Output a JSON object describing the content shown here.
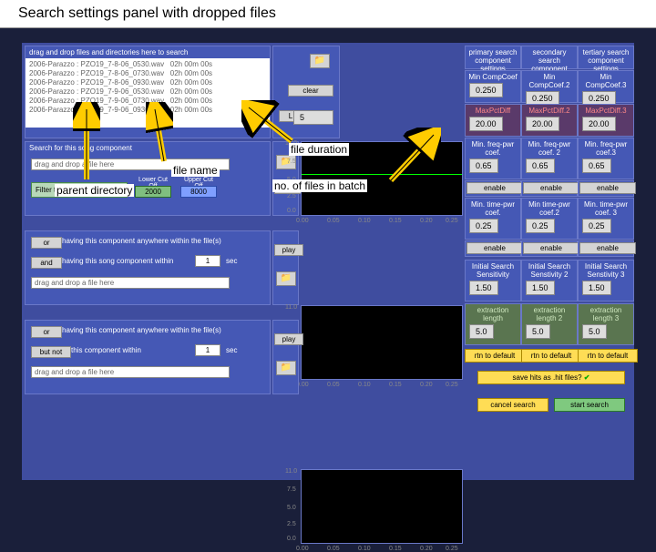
{
  "title": "Search settings panel with dropped files",
  "callouts": {
    "file_duration": "file duration",
    "file_name": "file name",
    "parent_directory": "parent directory",
    "no_files": "no. of files in batch"
  },
  "drop_header": "drag and drop files and directories here to search",
  "files": [
    {
      "dir": "2006-Parazzo",
      "name": "PZO19_7-8-06_0530.wav",
      "dur": "02h 00m 00s"
    },
    {
      "dir": "2006-Parazzo",
      "name": "PZO19_7-8-06_0730.wav",
      "dur": "02h 00m 00s"
    },
    {
      "dir": "2006-Parazzo",
      "name": "PZO19_7-8-06_0930.wav",
      "dur": "02h 00m 00s"
    },
    {
      "dir": "2006-Parazzo",
      "name": "PZO19_7-9-06_0530.wav",
      "dur": "02h 00m 00s"
    },
    {
      "dir": "2006-Parazzo",
      "name": "PZO19_7-9-06_0730.wav",
      "dur": "02h 00m 00s"
    },
    {
      "dir": "2006-Parazzo",
      "name": "PZO19_7-9-06_0930.wav",
      "dur": "02h 00m 00s"
    }
  ],
  "clear": "clear",
  "batch_count": "5",
  "stereo": "L",
  "search_for": "Search for this song component",
  "drop_msg": "drag and drop a file here",
  "filter_label": "Filter the search file",
  "lower_cutoff": "Lower Cut Off",
  "upper_cutoff": "Upper Cut Off",
  "lower_val": "2000",
  "upper_val": "8000",
  "play": "play",
  "or": "or",
  "and": "and",
  "but_not": "but not",
  "having_anywhere": "having this component anywhere within the file(s)",
  "having_within": "having this song component within",
  "this_within": "this component within",
  "sec": "sec",
  "one": "1",
  "cols": {
    "primary": "primary search component settings",
    "secondary": "secondary search component settings",
    "tertiary": "tertiary search component settings"
  },
  "min_compcoef": {
    "l": "Min CompCoef",
    "l2": "Min CompCoef.2",
    "l3": "Min CompCoef.3",
    "v1": "0.250",
    "v2": "0.250",
    "v3": "0.250"
  },
  "maxpctdiff": {
    "l": "MaxPctDiff",
    "l2": "MaxPctDiff.2",
    "l3": "MaxPctDiff.3",
    "v1": "20.00",
    "v2": "20.00",
    "v3": "20.00"
  },
  "min_freqpwr": {
    "l": "Min. freq-pwr coef.",
    "l2": "Min. freq-pwr coef. 2",
    "l3": "Min. freq-pwr coef.3",
    "v1": "0.65",
    "v2": "0.65",
    "v3": "0.65"
  },
  "enable": "enable",
  "min_timepwr": {
    "l": "Min. time-pwr coef.",
    "l2": "Min time-pwr coef.2",
    "l3": "Min. time-pwr coef. 3",
    "v1": "0.25",
    "v2": "0.25",
    "v3": "0.25"
  },
  "init_sens": {
    "l": "Initial Search Sensitivity",
    "l2": "Initial Search Senstivity 2",
    "l3": "Initial Search Senstivity 3",
    "v1": "1.50",
    "v2": "1.50",
    "v3": "1.50"
  },
  "extraction": {
    "l": "extraction length",
    "l2": "extraction length 2",
    "l3": "extraction length 3",
    "v1": "5.0",
    "v2": "5.0",
    "v3": "5.0"
  },
  "rtn_default": "rtn to default",
  "save_hits": "save hits as .hit files?",
  "cancel": "cancel search",
  "start": "start search",
  "axis": {
    "y": [
      "11.0",
      "7.5",
      "5.0",
      "2.5",
      "0.0"
    ],
    "x": [
      "0.00",
      "0.05",
      "0.10",
      "0.15",
      "0.20",
      "0.25"
    ]
  }
}
